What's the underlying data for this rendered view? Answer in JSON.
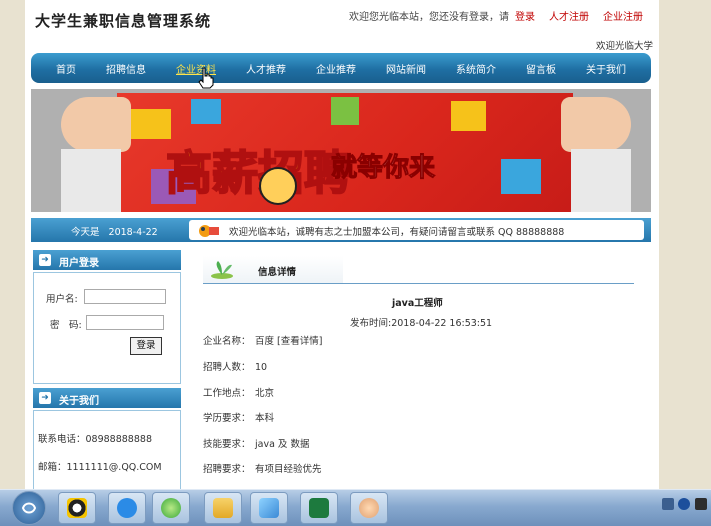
{
  "header": {
    "site_title": "大学生兼职信息管理系统",
    "top_welcome": "欢迎您光临本站，您还没有登录，请",
    "top_login": "登录",
    "top_talent_reg": "人才注册",
    "top_company_reg": "企业注册",
    "welcome_right": "欢迎光临大学"
  },
  "nav": {
    "items": [
      {
        "label": "首页"
      },
      {
        "label": "招聘信息"
      },
      {
        "label": "企业资料"
      },
      {
        "label": "人才推荐"
      },
      {
        "label": "企业推荐"
      },
      {
        "label": "网站新闻"
      },
      {
        "label": "系统简介"
      },
      {
        "label": "留言板"
      },
      {
        "label": "关于我们"
      }
    ],
    "active": "企业资料"
  },
  "banner": {
    "text_main": "高薪招聘",
    "text_sub": "就等你来"
  },
  "infobar": {
    "date_label": "今天是",
    "date": "2018-4-22",
    "marquee": "欢迎光临本站，诚聘有志之士加盟本公司，有疑问请留言或联系 QQ 88888888"
  },
  "sidebar": {
    "login_title": "用户登录",
    "username_label": "用户名:",
    "password_label": "密　码:",
    "username_value": "",
    "password_value": "",
    "login_button": "登录",
    "about_title": "关于我们",
    "phone": "联系电话：08988888888",
    "email": "邮箱：1111111@.QQ.COM"
  },
  "content": {
    "section_title": "信息详情",
    "job_title": "java工程师",
    "publish_time": "发布时间:2018-04-22 16:53:51",
    "fields": [
      {
        "key": "企业名称：",
        "value": "百度  [查看详情]"
      },
      {
        "key": "招聘人数：",
        "value": "10"
      },
      {
        "key": "工作地点：",
        "value": "北京"
      },
      {
        "key": "学历要求：",
        "value": "本科"
      },
      {
        "key": "技能要求：",
        "value": "java 及 数据"
      },
      {
        "key": "招聘要求：",
        "value": "有项目经验优先"
      }
    ]
  },
  "taskbar": {
    "apps": [
      "start-orb",
      "qq",
      "baidu-netdisk",
      "360-browser",
      "file-manager",
      "notepad",
      "excel",
      "chat-avatar"
    ]
  },
  "colors": {
    "nav_blue": "#1f6fa3",
    "link_red": "#c00000",
    "active_nav": "#ffe44a"
  }
}
